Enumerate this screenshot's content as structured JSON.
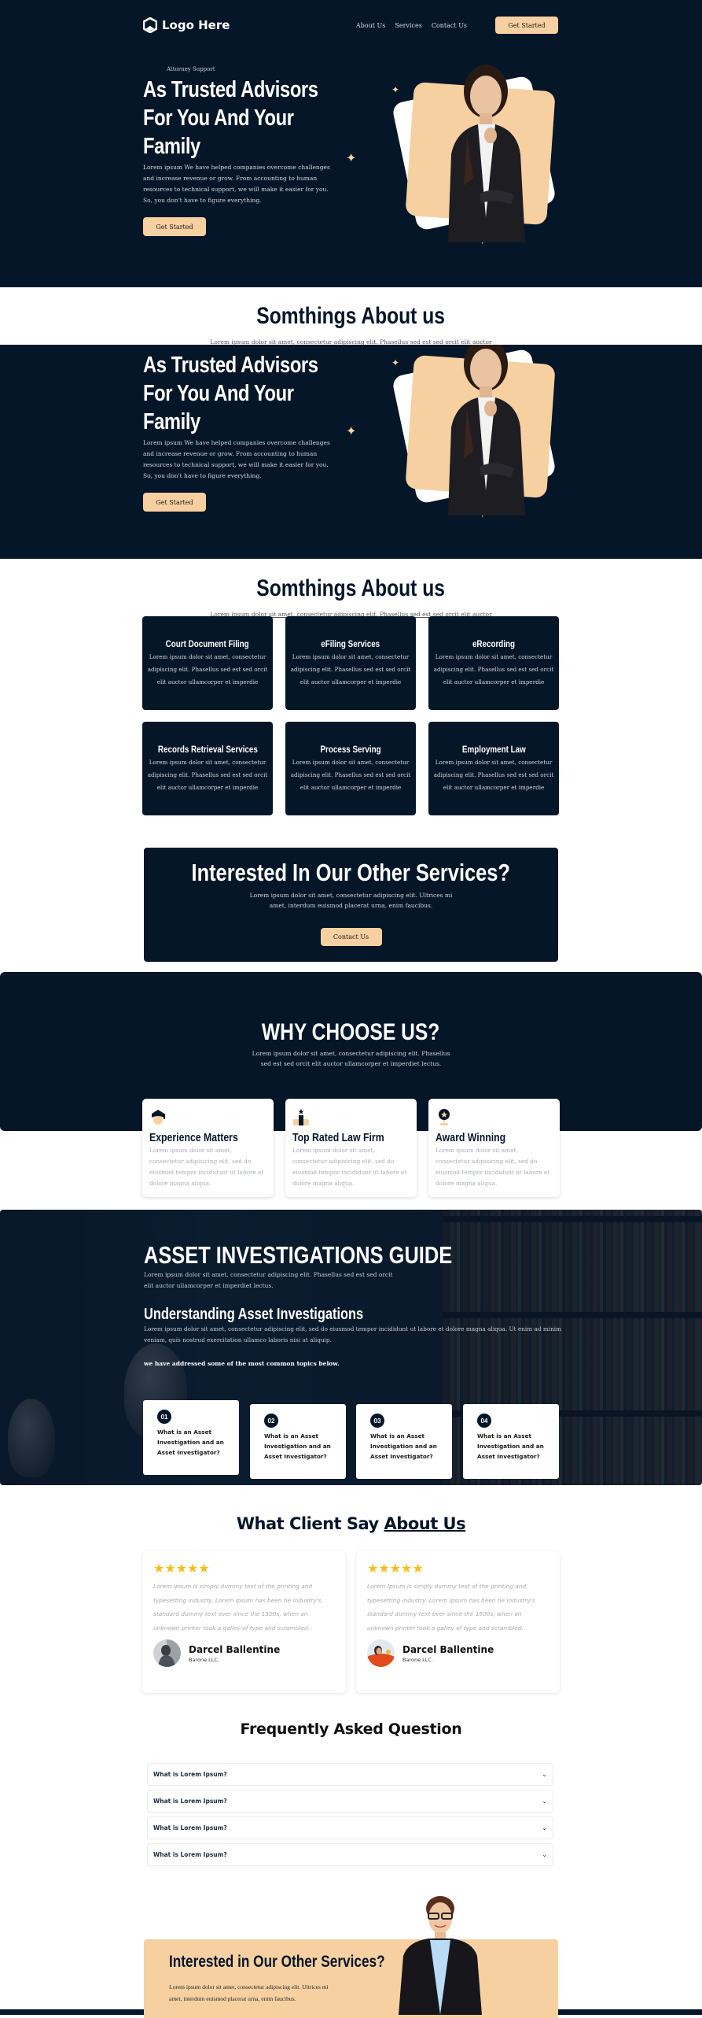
{
  "header": {
    "logo_text": "Logo Here",
    "nav": [
      "About Us",
      "Services",
      "Contact Us"
    ],
    "cta_label": "Get Started"
  },
  "hero": {
    "eyebrow": "Attorney Support",
    "title_lines": [
      "As Trusted Advisors",
      "For You And Your",
      "Family"
    ],
    "description": "Lorem ipsum We have helped companies overcome challenges and increase revenue or grow. From accounting to human resources to technical support, we will make it easier for you. So, you don't have to figure everything.",
    "cta_label": "Get Started"
  },
  "about": {
    "title": "Somthings About us",
    "subtitle": "Lorem ipsum dolor sit amet, consectetur adipiscing elit. Phasellus sed est sed orcit elit auctor"
  },
  "services": [
    {
      "title": "Court Document Filing",
      "text": "Lorem ipsum dolor sit amet, consectetur adipiscing elit. Phasellus sed est sed orcit elit auctor ullamcorper et imperdie"
    },
    {
      "title": "eFiling Services",
      "text": "Lorem ipsum dolor sit amet, consectetur adipiscing elit. Phasellus sed est sed orcit elit auctor ullamcorper et imperdie"
    },
    {
      "title": "eRecording",
      "text": "Lorem ipsum dolor sit amet, consectetur adipiscing elit. Phasellus sed est sed orcit elit auctor ullamcorper et imperdie"
    },
    {
      "title": "Records Retrieval Services",
      "text": "Lorem ipsum dolor sit amet, consectetur adipiscing elit. Phasellus sed est sed orcit elit auctor ullamcorper et imperdie"
    },
    {
      "title": "Process Serving",
      "text": "Lorem ipsum dolor sit amet, consectetur adipiscing elit. Phasellus sed est sed orcit elit auctor ullamcorper et imperdie"
    },
    {
      "title": "Employment Law",
      "text": "Lorem ipsum dolor sit amet, consectetur adipiscing elit. Phasellus sed est sed orcit elit auctor ullamcorper et imperdie"
    }
  ],
  "cta_services": {
    "title": "Interested In Our Other Services?",
    "text": "Lorem ipsum dolor sit amet, consectetur adipiscing elit. Ultrices mi amet, interdum euismod placerat urna, enim faucibus.",
    "button": "Contact Us"
  },
  "why": {
    "title": "WHY CHOOSE US?",
    "text": "Lorem ipsum dolor sit amet, consectetur adipiscing elit. Phasellus sed est sed orcit elit auctor ullamcorper et imperdiet lectus.",
    "cards": [
      {
        "icon": "graduate-icon",
        "title": "Experience Matters",
        "text": "Lorem ipsum dolor sit amet, consectetur adipisicing elit, sed do eiusmod tempor incididunt ut labore et dolore magna aliqua."
      },
      {
        "icon": "podium-star-icon",
        "title": "Top Rated Law Firm",
        "text": "Lorem ipsum dolor sit amet, consectetur adipisicing elit, sed do eiusmod tempor incididunt ut labore et dolore magna aliqua."
      },
      {
        "icon": "trophy-icon",
        "title": "Award Winning",
        "text": "Lorem ipsum dolor sit amet, consectetur adipisicing elit, sed do eiusmod tempor incididunt ut labore et dolore magna aliqua."
      }
    ]
  },
  "asset": {
    "title": "ASSET INVESTIGATIONS GUIDE",
    "description": "Lorem ipsum dolor sit amet, consectetur adipiscing elit. Phasellus sed est sed orcit elit auctor ullamcorper et imperdiet lectus.",
    "subtitle": "Understanding Asset Investigations",
    "description2": "Lorem ipsum dolor sit amet, consectetur adipiscing elit, sed do eiusmod tempor incididunt ut labore et dolore magna aliqua. Ut enim ad minim veniam, quis nostrud exercitation ullamco laboris nisi ut aliquip.",
    "note": "we have addressed some of the most common topics below.",
    "topics": [
      {
        "num": "01",
        "question": "What is an Asset Investigation and an Asset Investigator?"
      },
      {
        "num": "02",
        "question": "What is an Asset Investigation and an Asset Investigator?"
      },
      {
        "num": "03",
        "question": "What is an Asset Investigation and an Asset Investigator?"
      },
      {
        "num": "04",
        "question": "What is an Asset Investigation and an Asset Investigator?"
      }
    ]
  },
  "testimonials": {
    "title_prefix": "What Client Say",
    "title_link": "About Us",
    "items": [
      {
        "stars": "★★★★★",
        "rating": 5,
        "quote": "Lorem Ipsum is simply dummy text of the printing and typesetting industry. Lorem Ipsum has been he industry's standard dummy text ever since the 1500s, when an unknown printer took a galley of type and scrambled.",
        "name": "Darcel Ballentine",
        "company": "Barone LLC."
      },
      {
        "stars": "★★★★★",
        "rating": 5,
        "quote": "Lorem Ipsum is simply dummy text of the printing and typesetting industry. Lorem Ipsum has been he industry's standard dummy text ever since the 1500s, when an unknown printer took a galley of type and scrambled.",
        "name": "Darcel Ballentine",
        "company": "Barone LLC."
      }
    ]
  },
  "faq": {
    "title": "Frequently Asked Question",
    "items": [
      "What is Lorem Ipsum?",
      "What is Lorem Ipsum?",
      "What is Lorem Ipsum?",
      "What is Lorem Ipsum?"
    ],
    "chevron": "⌄"
  },
  "cta_bottom": {
    "title": "Interested in Our Other Services?",
    "text": "Lorem ipsum dolor sit amet, consectetur adipiscing elit. Ultrices mi amet, interdum euismod placerat urna, enim faucibus."
  },
  "colors": {
    "navy": "#041628",
    "peach": "#f7d0a1",
    "star": "#f8bd1b",
    "white": "#ffffff"
  },
  "sparkle_glyph": "✦"
}
